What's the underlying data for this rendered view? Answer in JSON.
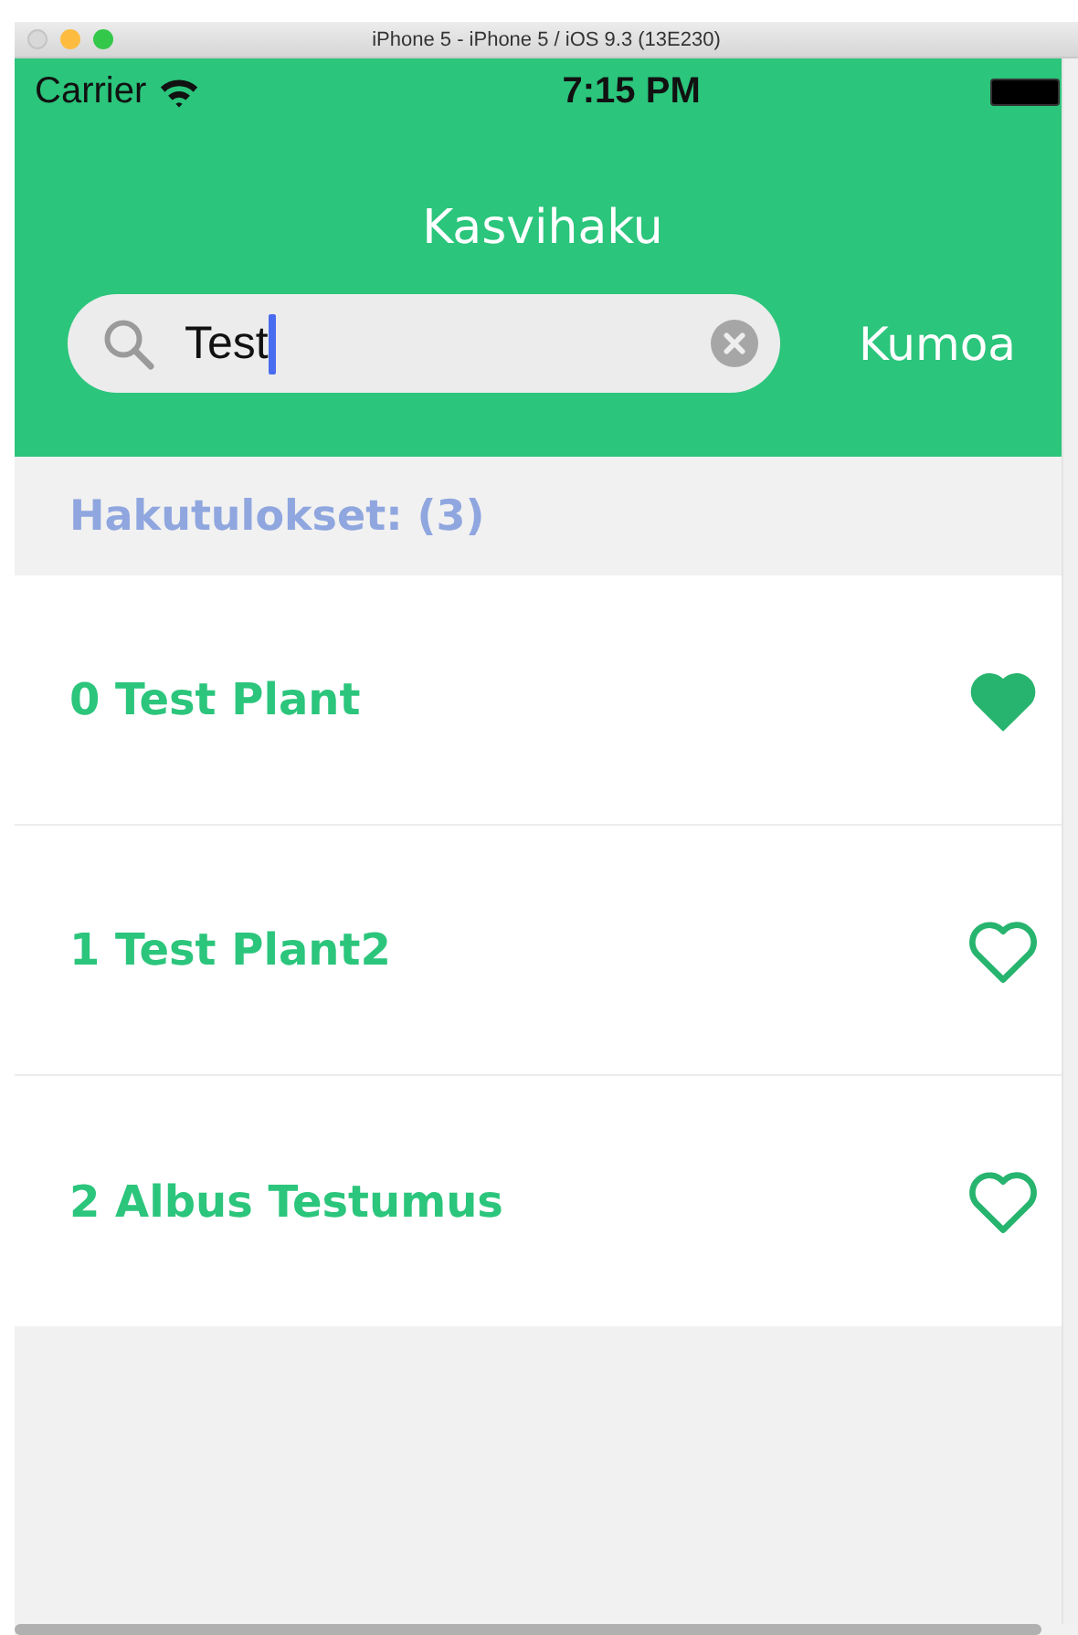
{
  "window": {
    "title": "iPhone 5 - iPhone 5 / iOS 9.3 (13E230)"
  },
  "status_bar": {
    "carrier": "Carrier",
    "time": "7:15 PM"
  },
  "nav": {
    "title": "Kasvihaku"
  },
  "search": {
    "value": "Test",
    "cancel": "Kumoa"
  },
  "results": {
    "header": "Hakutulokset: (3)",
    "items": [
      {
        "name": "0 Test Plant",
        "favorite": true
      },
      {
        "name": "1 Test Plant2",
        "favorite": false
      },
      {
        "name": "2 Albus Testumus",
        "favorite": false
      }
    ]
  }
}
